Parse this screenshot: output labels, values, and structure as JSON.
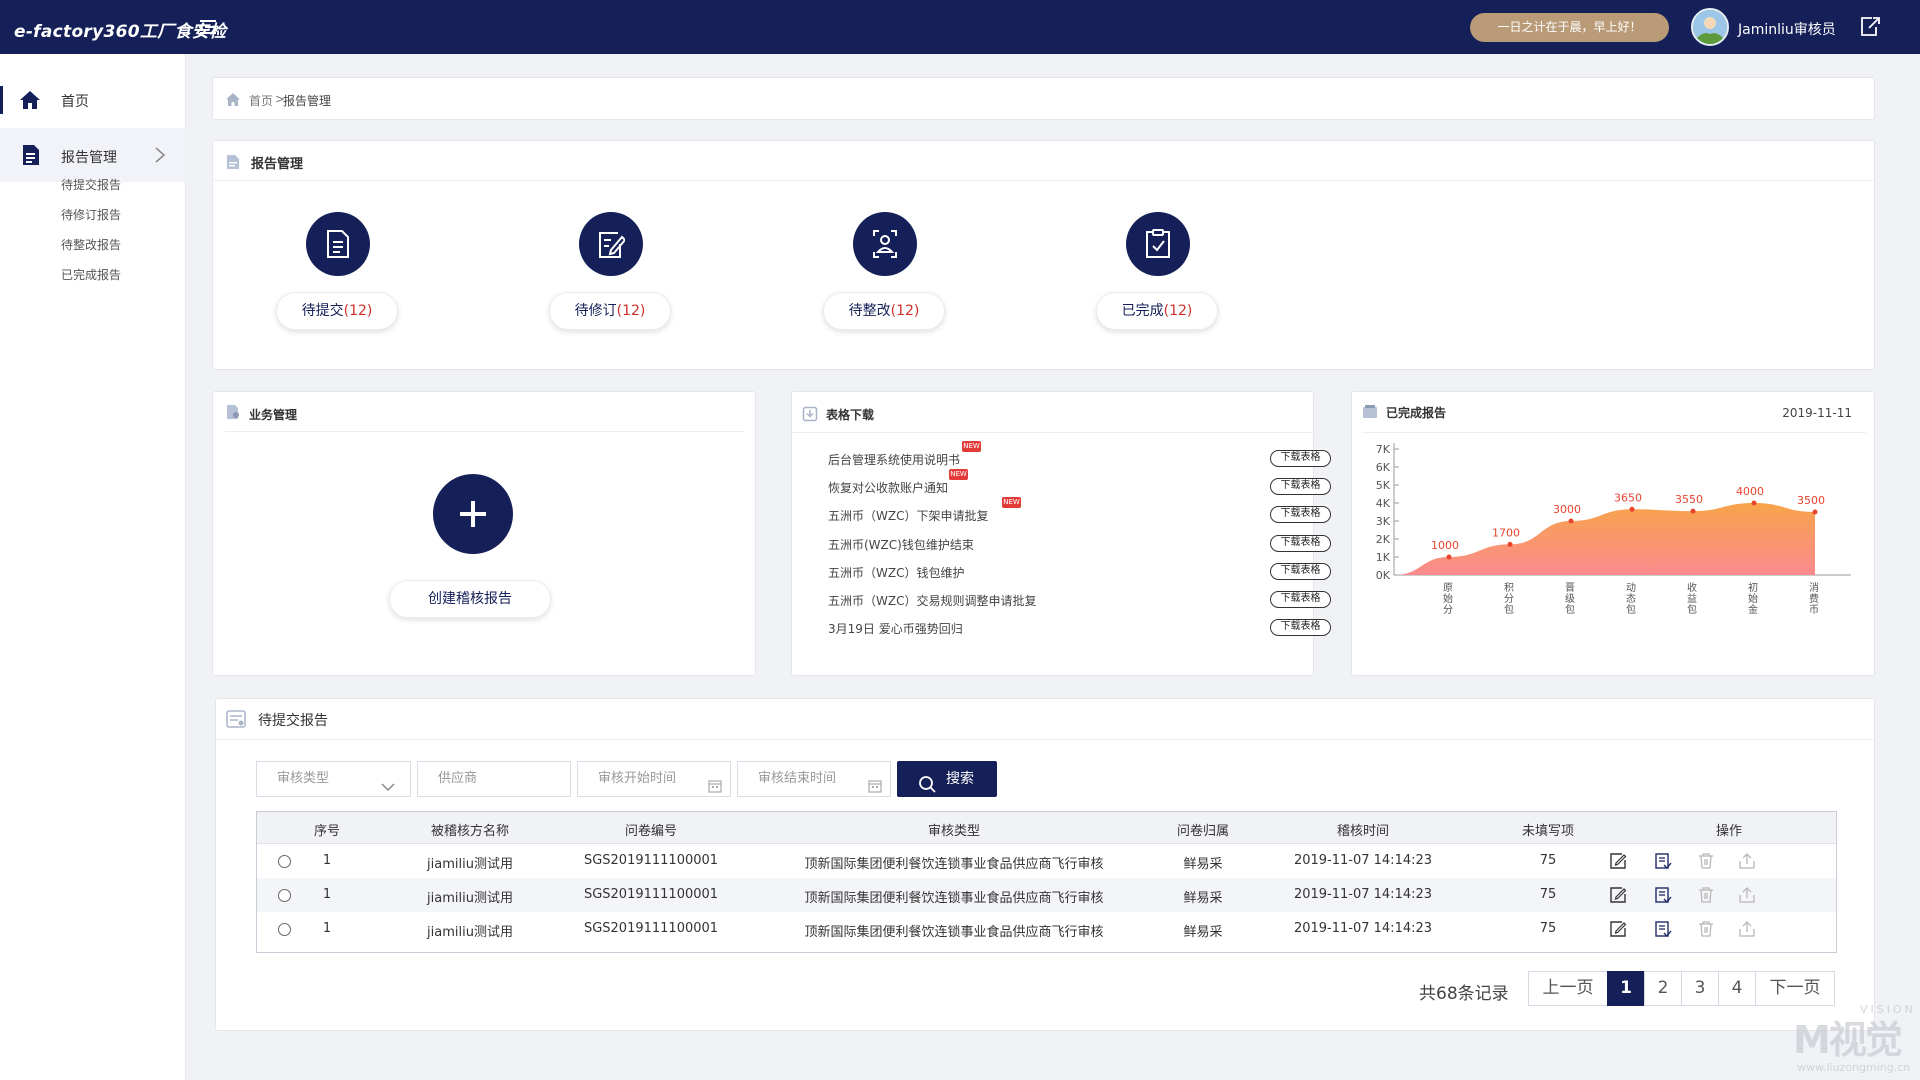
{
  "header": {
    "brand": "e-factory360工厂食安检",
    "greeting": "一日之计在于晨，早上好！",
    "user": "Jaminliu审核员"
  },
  "sidebar": {
    "home": "首页",
    "report_mgmt": "报告管理",
    "sub_items": [
      "待提交报告",
      "待修订报告",
      "待整改报告",
      "已完成报告"
    ]
  },
  "breadcrumb": {
    "home": "首页",
    "sep": ">",
    "current": "报告管理"
  },
  "report_mgmt": {
    "title": "报告管理",
    "stats": [
      {
        "label": "待提交",
        "count": "(12)"
      },
      {
        "label": "待修订",
        "count": "(12)"
      },
      {
        "label": "待整改",
        "count": "(12)"
      },
      {
        "label": "已完成",
        "count": "(12)"
      }
    ]
  },
  "business": {
    "title": "业务管理",
    "create_label": "创建稽核报告"
  },
  "forms": {
    "title": "表格下载",
    "new_badge": "NEW",
    "download_label": "下载表格",
    "items": [
      {
        "text": "后台管理系统使用说明书",
        "is_new": true
      },
      {
        "text": "恢复对公收款账户通知",
        "is_new": true
      },
      {
        "text": "五洲币（WZC）下架申请批复",
        "is_new": true
      },
      {
        "text": " 五洲币(WZC)钱包维护结束",
        "is_new": false
      },
      {
        "text": "五洲币（WZC）钱包维护",
        "is_new": false
      },
      {
        "text": "五洲币（WZC）交易规则调整申请批复",
        "is_new": false
      },
      {
        "text": "3月19日 爱心币强势回归",
        "is_new": false
      }
    ]
  },
  "completed": {
    "title": "已完成报告",
    "date": "2019-11-11"
  },
  "chart_data": {
    "type": "area",
    "categories": [
      "原始分",
      "积分包",
      "晋级包",
      "动态包",
      "收益包",
      "初始金",
      "消费币"
    ],
    "values": [
      1000,
      1700,
      3000,
      3650,
      3550,
      4000,
      3500
    ],
    "ylim": [
      0,
      7000
    ],
    "yticks": [
      "0K",
      "1K",
      "2K",
      "3K",
      "4K",
      "5K",
      "6K",
      "7K"
    ],
    "colors": {
      "top": "#f7a44a",
      "bottom": "#fb8a8e",
      "marker": "#e8442e",
      "label": "#e8442e"
    }
  },
  "pending": {
    "title": "待提交报告",
    "filters": {
      "type_placeholder": "审核类型",
      "supplier_placeholder": "供应商",
      "start_placeholder": "审核开始时间",
      "end_placeholder": "审核结束时间",
      "search_label": "搜索"
    },
    "columns": [
      "序号",
      "被稽核方名称",
      "问卷编号",
      "审核类型",
      "问卷归属",
      "稽核时间",
      "未填写项",
      "操作"
    ],
    "rows": [
      {
        "no": "1",
        "name": "jiamiliu测试用",
        "code": "SGS2019111100001",
        "type": "顶新国际集团便利餐饮连锁事业食品供应商飞行审核",
        "owner": "鲜易采",
        "time": "2019-11-07 14:14:23",
        "missing": "75"
      },
      {
        "no": "1",
        "name": "jiamiliu测试用",
        "code": "SGS2019111100001",
        "type": "顶新国际集团便利餐饮连锁事业食品供应商飞行审核",
        "owner": "鲜易采",
        "time": "2019-11-07 14:14:23",
        "missing": "75"
      },
      {
        "no": "1",
        "name": "jiamiliu测试用",
        "code": "SGS2019111100001",
        "type": "顶新国际集团便利餐饮连锁事业食品供应商飞行审核",
        "owner": "鲜易采",
        "time": "2019-11-07 14:14:23",
        "missing": "75"
      }
    ],
    "pager": {
      "total": "共68条记录",
      "prev": "上一页",
      "pages": [
        "1",
        "2",
        "3",
        "4"
      ],
      "next": "下一页"
    }
  },
  "watermark": {
    "logo": "M视觉",
    "vision": "VISION",
    "url": "www.liuzongming.cn"
  }
}
